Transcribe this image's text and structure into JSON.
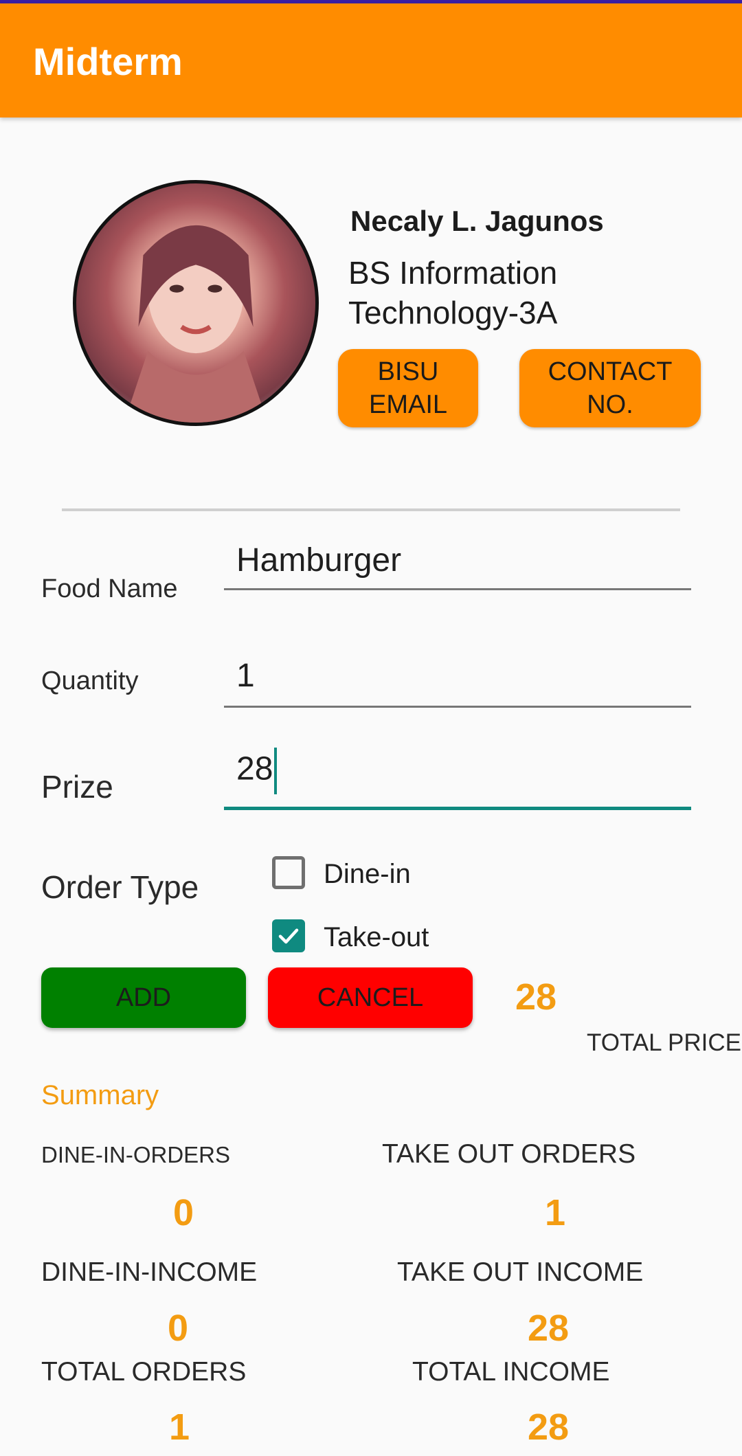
{
  "app": {
    "title": "Midterm"
  },
  "profile": {
    "name": "Necaly L. Jagunos",
    "program_line1": "BS Information",
    "program_line2": "Technology-3A",
    "email_button_line1": "BISU",
    "email_button_line2": "EMAIL",
    "contact_button_line1": "CONTACT",
    "contact_button_line2": "NO."
  },
  "form": {
    "food_name_label": "Food Name",
    "food_name_value": "Hamburger",
    "quantity_label": "Quantity",
    "quantity_value": "1",
    "prize_label": "Prize",
    "prize_value": "28",
    "order_type_label": "Order Type",
    "dine_in_label": "Dine-in",
    "dine_in_checked": false,
    "take_out_label": "Take-out",
    "take_out_checked": true
  },
  "actions": {
    "add_label": "ADD",
    "cancel_label": "CANCEL",
    "total_price_value": "28",
    "total_price_label": "TOTAL PRICE"
  },
  "summary": {
    "title": "Summary",
    "dine_in_orders_label": "DINE-IN-ORDERS",
    "dine_in_orders_value": "0",
    "take_out_orders_label": "TAKE OUT ORDERS",
    "take_out_orders_value": "1",
    "dine_in_income_label": "DINE-IN-INCOME",
    "dine_in_income_value": "0",
    "take_out_income_label": "TAKE OUT INCOME",
    "take_out_income_value": "28",
    "total_orders_label": "TOTAL ORDERS",
    "total_orders_value": "1",
    "total_income_label": "TOTAL INCOME",
    "total_income_value": "28"
  },
  "colors": {
    "app_bar": "#ff8c00",
    "accent": "#0f8a80",
    "add_button": "#008000",
    "cancel_button": "#ff0000",
    "highlight_number": "#f39c12"
  },
  "icons": {
    "take_out_checkbox": "check-icon"
  }
}
